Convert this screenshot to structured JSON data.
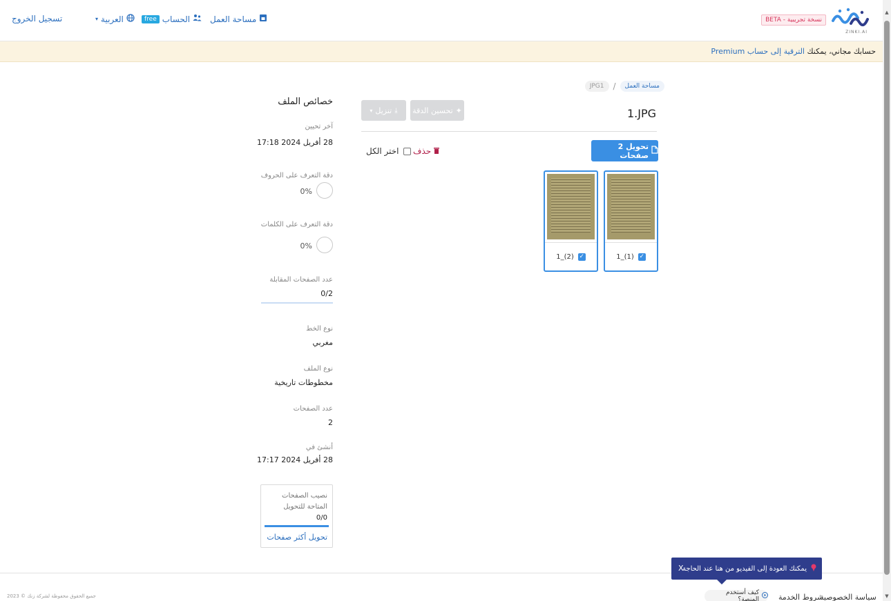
{
  "header": {
    "logout": "تسجيل الخروج",
    "language": "العربية",
    "account": "الحساب",
    "free_badge": "free",
    "workspace": "مساحة العمل",
    "beta_badge": "BETA - نسخة تجريبية",
    "logo_sub": "ZINKI.AI"
  },
  "banner": {
    "text": "حسابك مجاني، يمكنك",
    "link": "الترقية إلى حساب Premium"
  },
  "breadcrumb": {
    "root": "مساحة العمل",
    "current": "JPG1"
  },
  "file": {
    "title": "1.JPG"
  },
  "toolbar": {
    "enhance_label": "تحسين الدقة",
    "download_label": "تنزيل",
    "convert_label": "تحويل 2 صفحات",
    "delete_label": "حذف",
    "select_all_label": "اختر الكل"
  },
  "thumbnails": [
    {
      "label": "1_(1)"
    },
    {
      "label": "1_(2)"
    }
  ],
  "properties": {
    "title": "خصائص الملف",
    "last_update_label": "آخر تحيين",
    "last_update_value": "28 أفريل 2024 17:18",
    "char_accuracy_label": "دقة التعرف على الحروف",
    "char_accuracy_value": "0%",
    "word_accuracy_label": "دقة التعرف على الكلمات",
    "word_accuracy_value": "0%",
    "matched_pages_label": "عدد الصفحات المقابلة",
    "matched_pages_value": "0/2",
    "script_type_label": "نوع الخط",
    "script_type_value": "مغربي",
    "file_type_label": "نوع الملف",
    "file_type_value": "مخطوطات تاريخية",
    "page_count_label": "عدد الصفحات",
    "page_count_value": "2",
    "created_label": "أنشئ في",
    "created_value": "28 أفريل 2024 17:17"
  },
  "quota": {
    "label": "نصيب الصفحات المتاحة للتحويل",
    "value": "0/0",
    "link": "تحويل أكثر صفحات"
  },
  "footer": {
    "copyright": "جميع الحقوق محفوظة لشركة زنك © 2023",
    "privacy": "سياسة الخصوصية",
    "terms": "شروط الخدمة",
    "how_to": "كيف أستخدم المنصة؟"
  },
  "toast": {
    "text": "يمكنك العودة إلى الفيديو من هنا عند الحاجة",
    "close": "X"
  },
  "colors": {
    "primary": "#3a8fe3",
    "link": "#2c6fbe",
    "danger": "#b0204a",
    "banner_bg": "#fbf3e0",
    "toast_bg": "#2f3d8c"
  }
}
